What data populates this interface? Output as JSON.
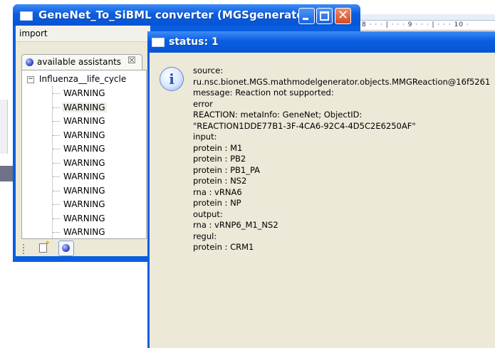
{
  "main_window": {
    "title": "GeneNet_To_SiBML converter (MGSgenerator)",
    "menu": [
      "import"
    ]
  },
  "assistants_view": {
    "tab_label": "available assistants",
    "tree": {
      "root": "Influenza__life_cycle",
      "items": [
        "WARNING",
        "WARNING",
        "WARNING",
        "WARNING",
        "WARNING",
        "WARNING",
        "WARNING",
        "WARNING",
        "WARNING",
        "WARNING",
        "WARNING"
      ],
      "selected_index": 1
    }
  },
  "status_dialog": {
    "title": "status: 1",
    "icon": "info-icon",
    "lines": [
      "source:",
      "ru.nsc.bionet.MGS.mathmodelgenerator.objects.MMGReaction@16f5261",
      "message: Reaction not supported:",
      "error",
      "REACTION:  metaInfo: GeneNet; ObjectID:",
      "\"REACTION1DDE77B1-3F-4CA6-92C4-4D5C2E6250AF\"",
      "input:",
      "protein : M1",
      "protein : PB2",
      "protein : PB1_PA",
      "protein : NS2",
      "rna : vRNA6",
      "protein : NP",
      "output:",
      "rna : vRNP6_M1_NS2",
      "regul:",
      "protein : CRM1"
    ]
  },
  "background": {
    "ruler_ticks": "8 · · · | · · · 9 · · · | · · · 10 ·"
  },
  "colors": {
    "titlebar_blue": "#0b5de1",
    "client_bg": "#ece9d8",
    "close_red": "#d64a1f"
  }
}
